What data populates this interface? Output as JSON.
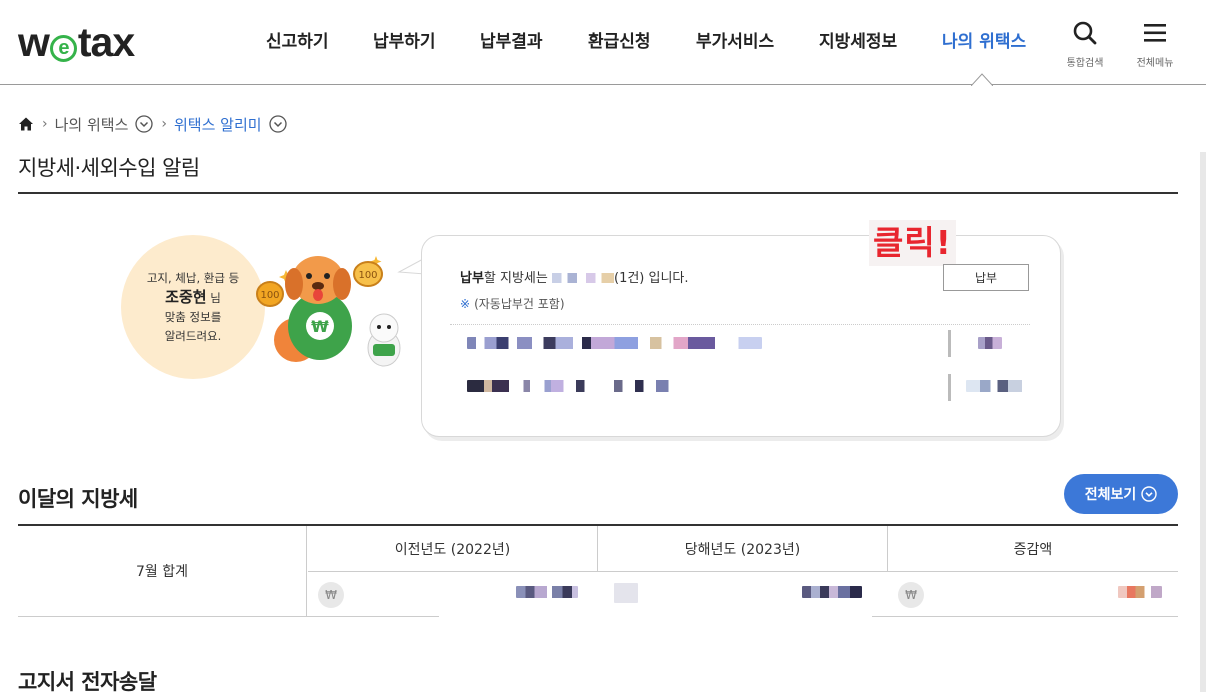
{
  "header": {
    "logo_pre": "w",
    "logo_e": "e",
    "logo_post": "tax",
    "nav": [
      {
        "label": "신고하기"
      },
      {
        "label": "납부하기"
      },
      {
        "label": "납부결과"
      },
      {
        "label": "환급신청"
      },
      {
        "label": "부가서비스"
      },
      {
        "label": "지방세정보"
      },
      {
        "label": "나의 위택스",
        "active": true
      }
    ],
    "search_label": "통합검색",
    "menu_label": "전체메뉴"
  },
  "breadcrumb": {
    "level1": "나의 위택스",
    "level2": "위택스 알리미"
  },
  "page_title": "지방세·세외수입 알림",
  "notice": {
    "line1": "고지, 체납, 환급 등",
    "name": "조중현",
    "name_suffix": "님",
    "line2": "맞춤 정보를",
    "line3": "알려드려요."
  },
  "card": {
    "click_label": "클릭!",
    "pay_bold": "납부",
    "pay_text": "할 지방세는",
    "pay_count": "(1건)",
    "pay_tail": "입니다.",
    "note_mark": "※",
    "note_text": "(자동납부건 포함)",
    "pay_button": "납부"
  },
  "month": {
    "title": "이달의 지방세",
    "view_all": "전체보기",
    "row_label": "7월 합계",
    "columns": [
      "이전년도 (2022년)",
      "당해년도 (2023년)",
      "증감액"
    ],
    "currency": "₩"
  },
  "next_section_title": "고지서 전자송달",
  "colors": {
    "accent": "#2f6fd0",
    "brand_green": "#35b34a",
    "button_blue": "#3c78d8",
    "click_red": "#e8262f",
    "peach": "#fdebcd"
  }
}
